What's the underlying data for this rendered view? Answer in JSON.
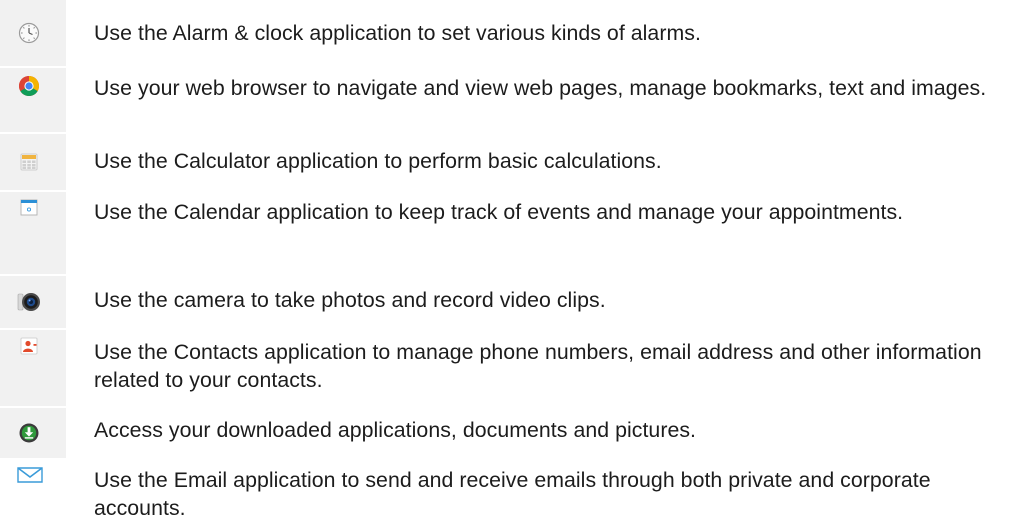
{
  "rows": [
    {
      "icon": "alarm-clock-icon",
      "text": "Use the Alarm & clock application to set various kinds of alarms."
    },
    {
      "icon": "web-browser-icon",
      "text": "Use your web browser to navigate and view web pages, manage bookmarks, text and images."
    },
    {
      "icon": "calculator-icon",
      "text": "Use the Calculator application to perform basic calculations."
    },
    {
      "icon": "calendar-icon",
      "text": "Use the Calendar application to keep track of events and manage your appointments."
    },
    {
      "icon": "camera-icon",
      "text": "Use the camera to take photos and record video clips."
    },
    {
      "icon": "contacts-icon",
      "text": "Use the Contacts application to manage phone numbers, email address and other information related to your contacts."
    },
    {
      "icon": "downloads-icon",
      "text": "Access your downloaded applications, documents and pictures."
    },
    {
      "icon": "email-icon",
      "text": "Use the Email application to send and receive emails through both private and corporate accounts."
    }
  ]
}
